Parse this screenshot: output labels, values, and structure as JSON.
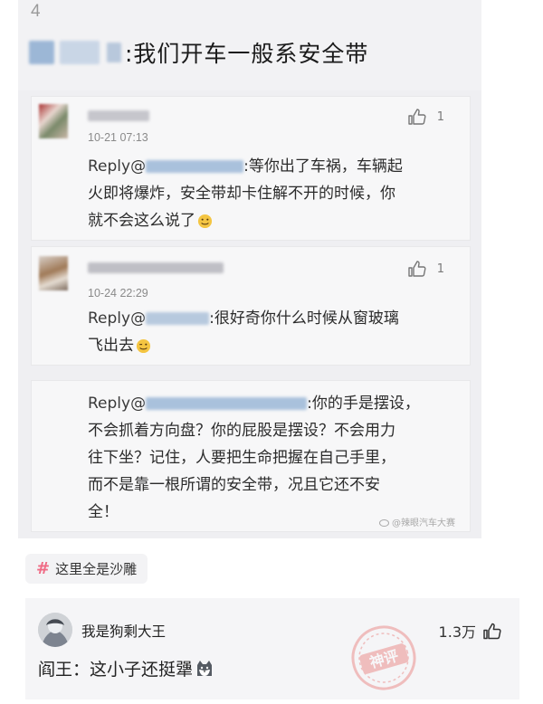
{
  "screenshot": {
    "floor_number": "4",
    "post_text": ":我们开车一般系安全带",
    "comments": [
      {
        "time": "10-21 07:13",
        "like_count": "1",
        "reply_prefix": "Reply@",
        "reply_lines": [
          ":等你出了车祸，车辆起",
          "火即将爆炸，安全带却卡住解不开的时候，你",
          "就不会这么说了"
        ]
      },
      {
        "time": "10-24 22:29",
        "like_count": "1",
        "reply_prefix": "Reply@",
        "reply_lines": [
          ":很好奇你什么时候从窗玻璃",
          "飞出去"
        ]
      },
      {
        "reply_prefix": "Reply@",
        "reply_lines": [
          ":你的手是摆设，",
          "不会抓着方向盘？你的屁股是摆设？不会用力",
          "往下坐？记住，人要把生命把握在自己手里，",
          "而不是靠一根所谓的安全带，况且它还不安",
          "全！"
        ]
      }
    ],
    "watermark": "@辣眼汽车大赛"
  },
  "tag": {
    "icon": "hash-icon",
    "label": "这里全是沙雕"
  },
  "comment": {
    "username": "我是狗剩大王",
    "likes": "1.3万",
    "text": "阎王：这小子还挺犟",
    "stamp_text": "神评",
    "accent_color": "#e0302a"
  }
}
